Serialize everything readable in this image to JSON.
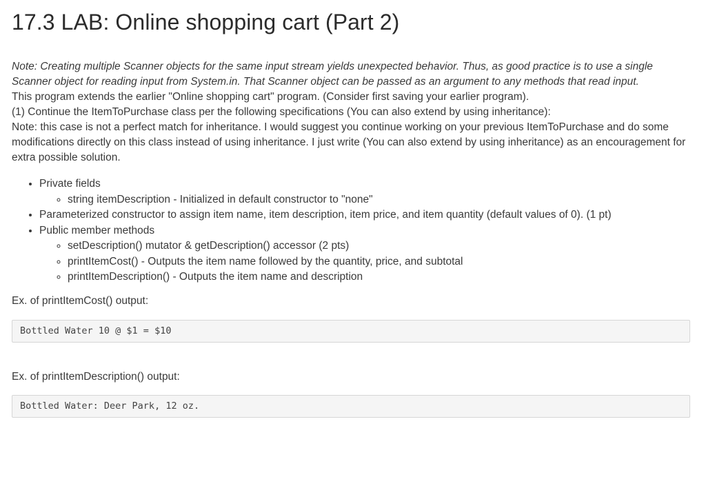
{
  "title": "17.3 LAB: Online shopping cart (Part 2)",
  "note": "Note: Creating multiple Scanner objects for the same input stream yields unexpected behavior. Thus, as good practice is to use a single Scanner object for reading input from System.in. That Scanner object can be passed as an argument to any methods that read input.",
  "intro": "This program extends the earlier \"Online shopping cart\" program. (Consider first saving your earlier program).",
  "step1": "(1) Continue the ItemToPurchase class per the following specifications (You can also extend by using inheritance):",
  "note2": "Note: this case is not a perfect match for inheritance. I would suggest you continue working on your previous ItemToPurchase and do some modifications directly on this class instead of using inheritance. I just write (You can also extend by using inheritance) as an encouragement for extra possible solution.",
  "spec": {
    "private_fields": "Private fields",
    "field_item_description": "string itemDescription - Initialized in default constructor to \"none\"",
    "param_constructor": "Parameterized constructor to assign item name, item description, item price, and item quantity (default values of 0). (1 pt)",
    "public_methods": "Public member methods",
    "method_set_get_description": "setDescription() mutator & getDescription() accessor (2 pts)",
    "method_print_item_cost": "printItemCost() - Outputs the item name followed by the quantity, price, and subtotal",
    "method_print_item_description": "printItemDescription() - Outputs the item name and description"
  },
  "examples": {
    "cost_label": "Ex. of printItemCost() output:",
    "cost_output": "Bottled Water 10 @ $1 = $10",
    "description_label": "Ex. of printItemDescription() output:",
    "description_output": "Bottled Water: Deer Park, 12 oz."
  }
}
